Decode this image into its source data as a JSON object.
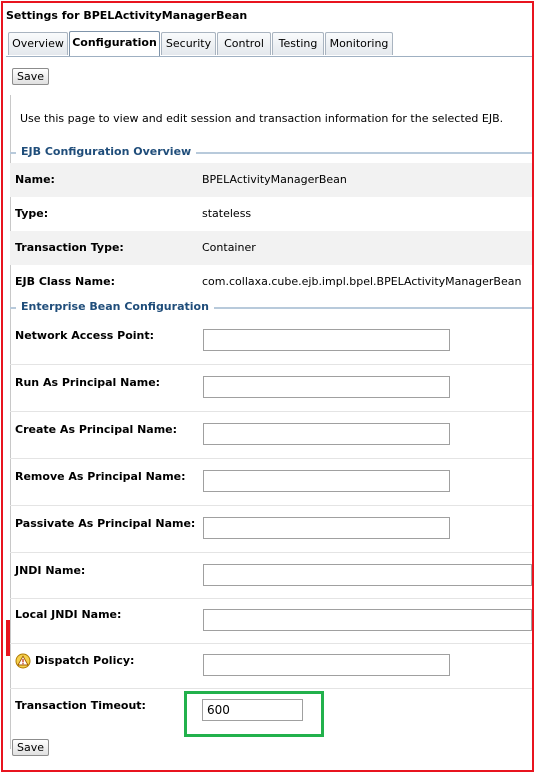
{
  "page_title": "Settings for BPELActivityManagerBean",
  "tabs": [
    {
      "label": "Overview"
    },
    {
      "label": "Configuration"
    },
    {
      "label": "Security"
    },
    {
      "label": "Control"
    },
    {
      "label": "Testing"
    },
    {
      "label": "Monitoring"
    }
  ],
  "active_tab": "Configuration",
  "save_label": "Save",
  "intro_text": "Use this page to view and edit session and transaction information for the selected EJB.",
  "overview_section": {
    "title": "EJB Configuration Overview",
    "rows": [
      {
        "label": "Name:",
        "value": "BPELActivityManagerBean"
      },
      {
        "label": "Type:",
        "value": "stateless"
      },
      {
        "label": "Transaction Type:",
        "value": "Container"
      },
      {
        "label": "EJB Class Name:",
        "value": "com.collaxa.cube.ejb.impl.bpel.BPELActivityManagerBean"
      }
    ]
  },
  "bean_section": {
    "title": "Enterprise Bean Configuration",
    "fields": [
      {
        "label": "Network Access Point:",
        "value": ""
      },
      {
        "label": "Run As Principal Name:",
        "value": ""
      },
      {
        "label": "Create As Principal Name:",
        "value": ""
      },
      {
        "label": "Remove As Principal Name:",
        "value": ""
      },
      {
        "label": "Passivate As Principal Name:",
        "value": ""
      },
      {
        "label": "JNDI Name:",
        "value": ""
      },
      {
        "label": "Local JNDI Name:",
        "value": ""
      },
      {
        "label": "Dispatch Policy:",
        "value": "",
        "icon": "warning-icon"
      },
      {
        "label": "Transaction Timeout:",
        "value": "600"
      }
    ]
  },
  "colors": {
    "frame_border": "#e8141f",
    "highlight_box": "#22b14c",
    "section_title": "#1f4d7a"
  }
}
